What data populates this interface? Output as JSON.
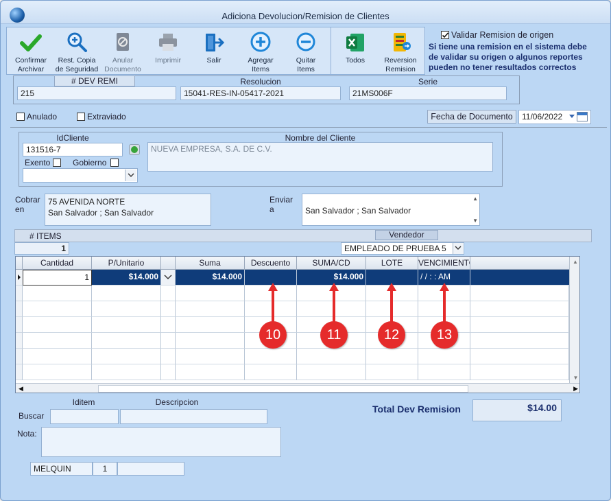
{
  "window": {
    "title": "Adiciona Devolucion/Remision de Clientes"
  },
  "toolbar": {
    "confirm": [
      "Confirmar",
      "Archivar"
    ],
    "restore": [
      "Rest. Copia",
      "de Seguridad"
    ],
    "cancel_doc": [
      "Anular",
      "Documento"
    ],
    "print": "Imprimir",
    "exit": "Salir",
    "add_items": [
      "Agregar",
      "Items"
    ],
    "remove_items": [
      "Quitar",
      "Items"
    ],
    "all": "Todos",
    "reversal": [
      "Reversion",
      "Remision"
    ]
  },
  "validation": {
    "checkbox_label": "Validar Remision de origen",
    "note": [
      "Si tiene una remision en el sistema debe",
      "de validar su origen o algunos reportes",
      "pueden no tener resultados correctos"
    ]
  },
  "header": {
    "dev_remi_label": "# DEV REMI",
    "dev_remi_value": "215",
    "resolution_label": "Resolucion",
    "resolution_value": "15041-RES-IN-05417-2021",
    "series_label": "Serie",
    "series_value": "21MS006F"
  },
  "flags": {
    "annulled": "Anulado",
    "lost": "Extraviado"
  },
  "document_date": {
    "label": "Fecha de  Documento",
    "value": "11/06/2022"
  },
  "client": {
    "id_label": "IdCliente",
    "id_value": "131516-7",
    "name_label": "Nombre del Cliente",
    "name_value": "NUEVA EMPRESA, S.A. DE C.V.",
    "exempt_label": "Exento",
    "government_label": "Gobierno"
  },
  "billing": {
    "label": [
      "Cobrar",
      "en"
    ],
    "line1": "75 AVENIDA NORTE",
    "line2": "San Salvador ; San Salvador"
  },
  "shipping": {
    "label": [
      "Enviar",
      "a"
    ],
    "line1": "San Salvador ; San Salvador"
  },
  "items_bar": {
    "items_label": "# ITEMS",
    "items_count": "1",
    "seller_label": "Vendedor",
    "seller_value": "EMPLEADO DE PRUEBA 5"
  },
  "grid": {
    "columns": [
      "Cantidad",
      "P/Unitario",
      "",
      "Suma",
      "Descuento",
      "SUMA/CD",
      "LOTE",
      "VENCIMIENTO"
    ],
    "row": {
      "quantity": "1",
      "unit_price": "$14.000",
      "sum": "$14.000",
      "discount": "",
      "sum_cd": "$14.000",
      "lot": "",
      "expiry": "/  /       :  :   AM"
    }
  },
  "callouts": [
    "10",
    "11",
    "12",
    "13"
  ],
  "footer": {
    "iditem_label": "Iditem",
    "description_label": "Descripcion",
    "search_label": "Buscar",
    "note_label": "Nota:",
    "total_label": "Total Dev Remision",
    "total_value": "$14.00",
    "user": "MELQUIN",
    "user_code": "1"
  },
  "colors": {
    "callout": "#e52b2b",
    "selected_row": "#0f3c7a",
    "window_bg": "#bcd7f4"
  }
}
